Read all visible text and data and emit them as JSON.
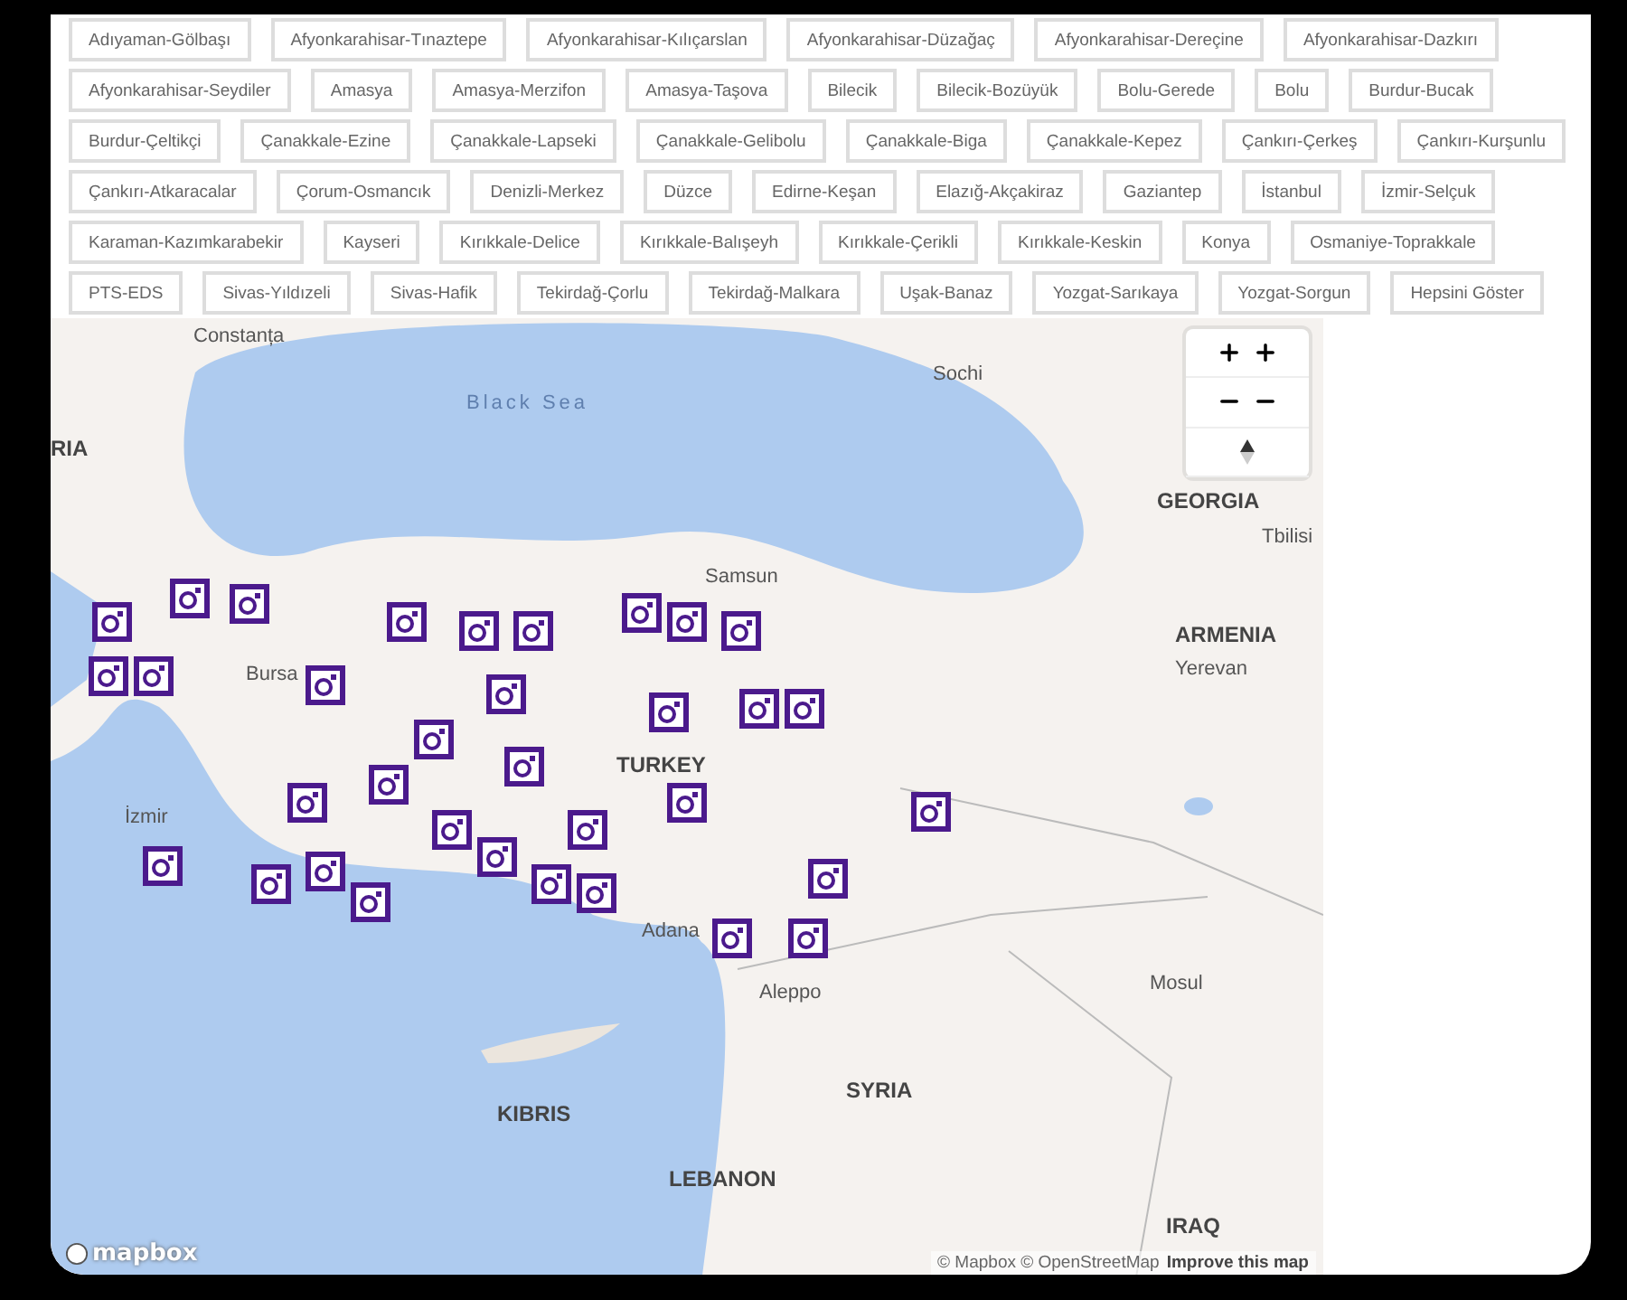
{
  "filters": [
    {
      "label": "Adıyaman-Gölbaşı"
    },
    {
      "label": "Afyonkarahisar-Tınaztepe"
    },
    {
      "label": "Afyonkarahisar-Kılıçarslan"
    },
    {
      "label": "Afyonkarahisar-Düzağaç"
    },
    {
      "label": "Afyonkarahisar-Dereçine"
    },
    {
      "label": "Afyonkarahisar-Dazkırı"
    },
    {
      "label": "Afyonkarahisar-Seydiler"
    },
    {
      "label": "Amasya"
    },
    {
      "label": "Amasya-Merzifon"
    },
    {
      "label": "Amasya-Taşova"
    },
    {
      "label": "Bilecik"
    },
    {
      "label": "Bilecik-Bozüyük"
    },
    {
      "label": "Bolu-Gerede"
    },
    {
      "label": "Bolu"
    },
    {
      "label": "Burdur-Bucak"
    },
    {
      "label": "Burdur-Çeltikçi"
    },
    {
      "label": "Çanakkale-Ezine"
    },
    {
      "label": "Çanakkale-Lapseki"
    },
    {
      "label": "Çanakkale-Gelibolu"
    },
    {
      "label": "Çanakkale-Biga"
    },
    {
      "label": "Çanakkale-Kepez"
    },
    {
      "label": "Çankırı-Çerkeş"
    },
    {
      "label": "Çankırı-Kurşunlu"
    },
    {
      "label": "Çankırı-Atkaracalar"
    },
    {
      "label": "Çorum-Osmancık"
    },
    {
      "label": "Denizli-Merkez"
    },
    {
      "label": "Düzce"
    },
    {
      "label": "Edirne-Keşan"
    },
    {
      "label": "Elazığ-Akçakiraz"
    },
    {
      "label": "Gaziantep"
    },
    {
      "label": "İstanbul"
    },
    {
      "label": "İzmir-Selçuk"
    },
    {
      "label": "Karaman-Kazımkarabekir"
    },
    {
      "label": "Kayseri"
    },
    {
      "label": "Kırıkkale-Delice"
    },
    {
      "label": "Kırıkkale-Balışeyh"
    },
    {
      "label": "Kırıkkale-Çerikli"
    },
    {
      "label": "Kırıkkale-Keskin"
    },
    {
      "label": "Konya"
    },
    {
      "label": "Osmaniye-Toprakkale"
    },
    {
      "label": "PTS-EDS"
    },
    {
      "label": "Sivas-Yıldızeli"
    },
    {
      "label": "Sivas-Hafik"
    },
    {
      "label": "Tekirdağ-Çorlu"
    },
    {
      "label": "Tekirdağ-Malkara"
    },
    {
      "label": "Uşak-Banaz"
    },
    {
      "label": "Yozgat-Sarıkaya"
    },
    {
      "label": "Yozgat-Sorgun"
    },
    {
      "label": "Hepsini Göster"
    }
  ],
  "map": {
    "labels": [
      {
        "text": "Constanța",
        "kind": "city"
      },
      {
        "text": "RIA",
        "kind": "country"
      },
      {
        "text": "Black Sea",
        "kind": "sea"
      },
      {
        "text": "Sochi",
        "kind": "city"
      },
      {
        "text": "GEORGIA",
        "kind": "country"
      },
      {
        "text": "Tbilisi",
        "kind": "city"
      },
      {
        "text": "Samsun",
        "kind": "city"
      },
      {
        "text": "ARMENIA",
        "kind": "country"
      },
      {
        "text": "Bursa",
        "kind": "city"
      },
      {
        "text": "Yerevan",
        "kind": "city"
      },
      {
        "text": "TURKEY",
        "kind": "country"
      },
      {
        "text": "İzmir",
        "kind": "city"
      },
      {
        "text": "Adana",
        "kind": "city"
      },
      {
        "text": "Aleppo",
        "kind": "city"
      },
      {
        "text": "Mosul",
        "kind": "city"
      },
      {
        "text": "SYRIA",
        "kind": "country"
      },
      {
        "text": "KIBRIS",
        "kind": "country"
      },
      {
        "text": "LEBANON",
        "kind": "country"
      },
      {
        "text": "IRAQ",
        "kind": "country"
      }
    ],
    "logo": "mapbox",
    "attribution": "© Mapbox © OpenStreetMap",
    "improve_link": "Improve this map"
  }
}
